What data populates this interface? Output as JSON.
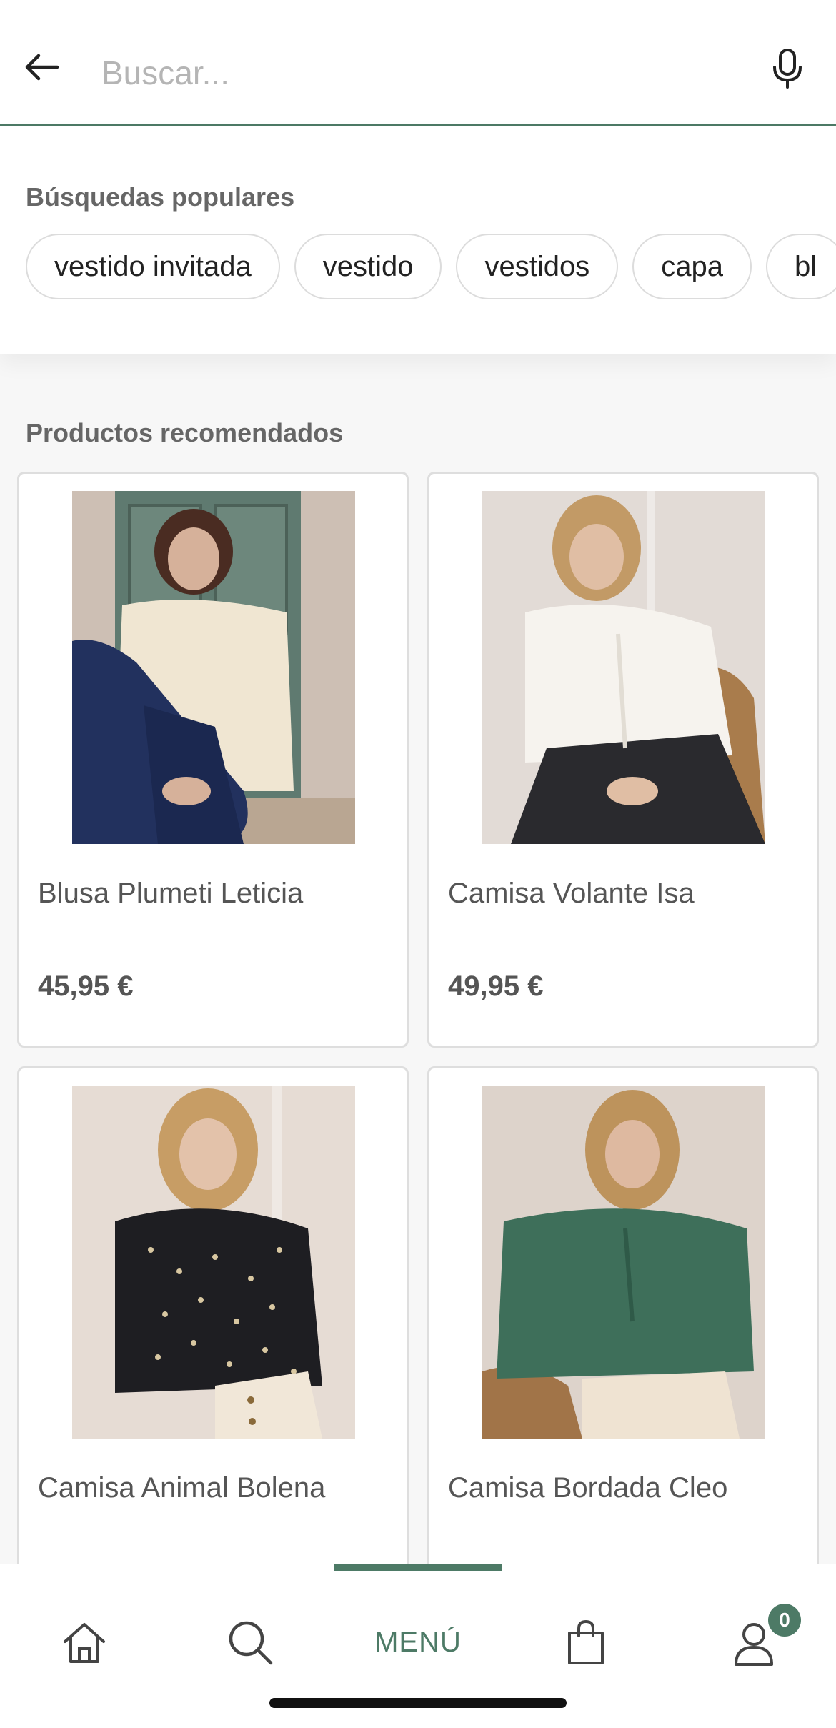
{
  "search": {
    "placeholder": "Buscar..."
  },
  "popular": {
    "title": "Búsquedas populares",
    "chips": [
      "vestido invitada",
      "vestido",
      "vestidos",
      "capa",
      "bl"
    ]
  },
  "recommended": {
    "title": "Productos recomendados",
    "products": [
      {
        "name": "Blusa Plumeti Leticia",
        "price": "45,95 €"
      },
      {
        "name": "Camisa Volante Isa",
        "price": "49,95 €"
      },
      {
        "name": "Camisa Animal Bolena",
        "price": ""
      },
      {
        "name": "Camisa Bordada Cleo",
        "price": ""
      }
    ]
  },
  "nav": {
    "items": [
      "home-icon",
      "search-icon",
      "menu",
      "bag-icon",
      "account-icon"
    ],
    "menu_label": "MENÚ",
    "cart_count": "0"
  },
  "colors": {
    "accent": "#4d7a66"
  }
}
